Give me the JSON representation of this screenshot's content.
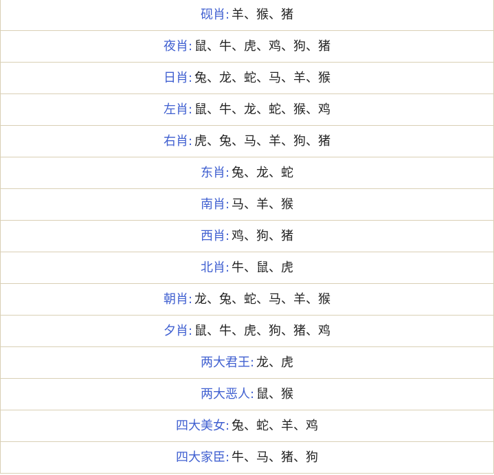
{
  "rows": [
    {
      "term": "砚肖",
      "value": "羊、猴、猪"
    },
    {
      "term": "夜肖",
      "value": "鼠、牛、虎、鸡、狗、猪"
    },
    {
      "term": "日肖",
      "value": "兔、龙、蛇、马、羊、猴"
    },
    {
      "term": "左肖",
      "value": "鼠、牛、龙、蛇、猴、鸡"
    },
    {
      "term": "右肖",
      "value": "虎、兔、马、羊、狗、猪"
    },
    {
      "term": "东肖",
      "value": "兔、龙、蛇"
    },
    {
      "term": "南肖",
      "value": "马、羊、猴"
    },
    {
      "term": "西肖",
      "value": "鸡、狗、猪"
    },
    {
      "term": "北肖",
      "value": "牛、鼠、虎"
    },
    {
      "term": "朝肖",
      "value": "龙、兔、蛇、马、羊、猴"
    },
    {
      "term": "夕肖",
      "value": "鼠、牛、虎、狗、猪、鸡"
    },
    {
      "term": "两大君王",
      "value": "龙、虎"
    },
    {
      "term": "两大恶人",
      "value": "鼠、猴"
    },
    {
      "term": "四大美女",
      "value": "兔、蛇、羊、鸡"
    },
    {
      "term": "四大家臣",
      "value": "牛、马、猪、狗"
    }
  ],
  "separator": ":"
}
